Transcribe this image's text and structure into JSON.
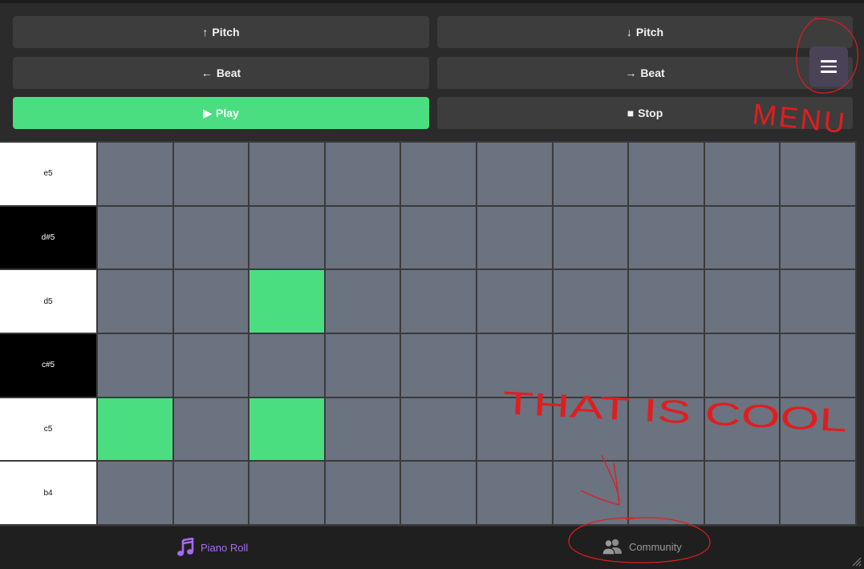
{
  "controls": {
    "pitch_up": {
      "arrow": "↑",
      "label": "Pitch"
    },
    "pitch_down": {
      "arrow": "↓",
      "label": "Pitch"
    },
    "beat_back": {
      "arrow": "←",
      "label": "Beat"
    },
    "beat_forward": {
      "arrow": "→",
      "label": "Beat"
    },
    "play": {
      "glyph": "▶",
      "label": "Play"
    },
    "stop": {
      "glyph": "■",
      "label": "Stop"
    }
  },
  "menu_button": {
    "icon": "hamburger-menu-icon"
  },
  "piano_roll": {
    "rows": [
      {
        "note": "e5",
        "key": "white",
        "active": []
      },
      {
        "note": "d#5",
        "key": "black",
        "active": []
      },
      {
        "note": "d5",
        "key": "white",
        "active": [
          2
        ]
      },
      {
        "note": "c#5",
        "key": "black",
        "active": []
      },
      {
        "note": "c5",
        "key": "white",
        "active": [
          0,
          2
        ]
      },
      {
        "note": "b4",
        "key": "white",
        "active": []
      }
    ],
    "beats_visible": 10
  },
  "bottom_nav": {
    "piano_roll": {
      "label": "Piano Roll",
      "icon": "music-note-icon",
      "active": true
    },
    "community": {
      "label": "Community",
      "icon": "users-icon",
      "active": false
    }
  },
  "annotations": {
    "menu_note": "MENU",
    "comment": "THAT IS COOL"
  },
  "colors": {
    "accent_green": "#4ade80",
    "accent_purple": "#a56bf0",
    "cell_gray": "#6b7280",
    "annotation_red": "#e11d1d"
  }
}
